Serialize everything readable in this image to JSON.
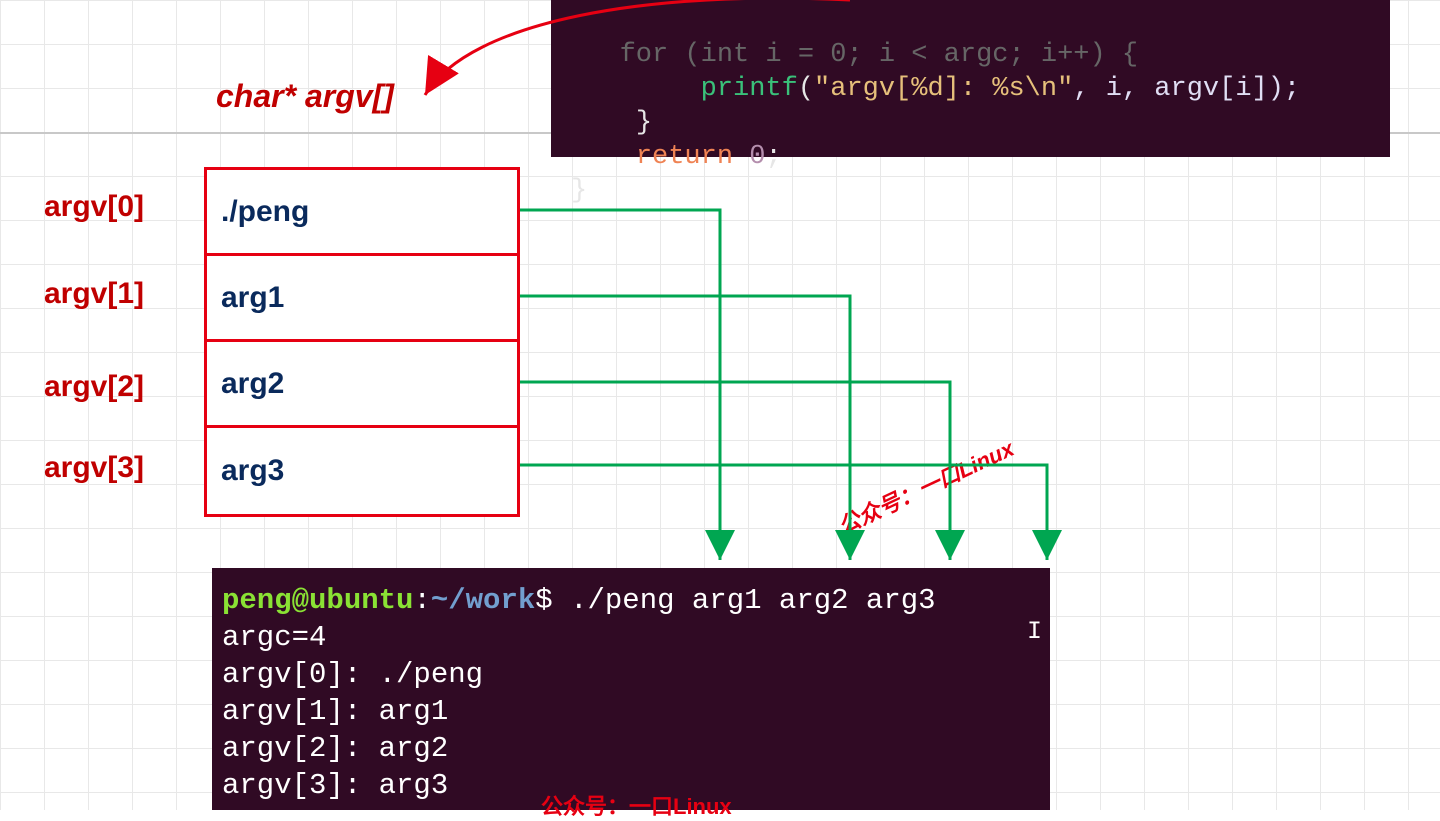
{
  "title_label": "char* argv[]",
  "argv_labels": [
    "argv[0]",
    "argv[1]",
    "argv[2]",
    "argv[3]"
  ],
  "argv_values": [
    "./peng",
    "arg1",
    "arg2",
    "arg3"
  ],
  "code_top": {
    "line0_obscured": "   for (int i = 0; i < argc; i++) {",
    "printf_fn": "printf",
    "printf_str": "\"argv[%d]: %s\\n\"",
    "printf_args": ", i, argv[i]);",
    "brace_inner": "}",
    "return_kw": "return",
    "return_val": "0",
    "semicolon": ";",
    "brace_outer": "}"
  },
  "terminal": {
    "user": "peng@ubuntu",
    "colon": ":",
    "path": "~/work",
    "prompt": "$ ",
    "command": "./peng arg1 arg2 arg3",
    "out": [
      "argc=4",
      "argv[0]: ./peng",
      "argv[1]: arg1",
      "argv[2]: arg2",
      "argv[3]: arg3"
    ]
  },
  "watermark": "公众号：一口Linux"
}
